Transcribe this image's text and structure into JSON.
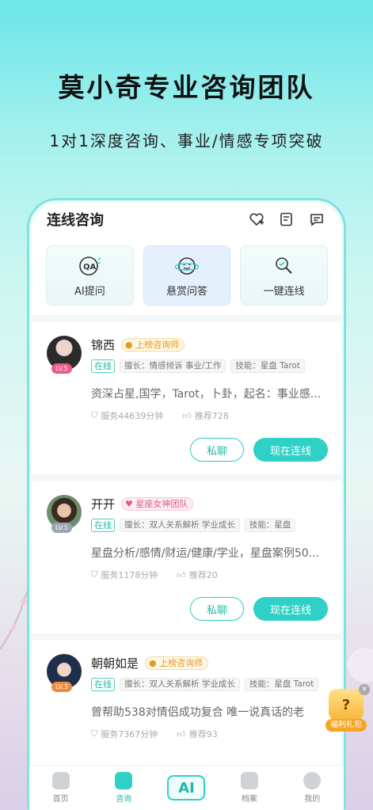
{
  "hero": {
    "title": "莫小奇专业咨询团队",
    "subtitle": "1对1深度咨询、事业/情感专项突破"
  },
  "topbar": {
    "title": "连线咨询",
    "icons": [
      "heart-plus-icon",
      "note-icon",
      "message-icon"
    ]
  },
  "quick_actions": [
    {
      "label": "AI提问",
      "icon": "qa-icon"
    },
    {
      "label": "悬赏问答",
      "icon": "planet-smile-icon"
    },
    {
      "label": "一键连线",
      "icon": "search-link-icon"
    }
  ],
  "consultants": [
    {
      "name": "锦西",
      "level": "LV.5",
      "badge": "上榜咨询师",
      "online": "在线",
      "tags": [
        "擅长：情感倾诉 事业/工作",
        "技能：星盘 Tarot"
      ],
      "desc": "资深占星,国学，Tarot，卜卦，起名：事业感...",
      "service": "服务44639分钟",
      "recommend": "推荐728",
      "chat_label": "私聊",
      "connect_label": "现在连线"
    },
    {
      "name": "开开",
      "level": "LV.1",
      "badge": "星座女神团队",
      "online": "在线",
      "tags": [
        "擅长：双人关系解析 学业成长",
        "技能：星盘"
      ],
      "desc": "星盘分析/感情/财运/健康/学业，星盘案例50...",
      "service": "服务1178分钟",
      "recommend": "推荐20",
      "chat_label": "私聊",
      "connect_label": "现在连线"
    },
    {
      "name": "朝朝如是",
      "level": "LV.3",
      "badge": "上榜咨询师",
      "online": "在线",
      "tags": [
        "擅长：双人关系解析 学业成长",
        "技能：星盘 Tarot"
      ],
      "desc": "曾帮助538对情侣成功复合  唯一说真话的老",
      "service": "服务7367分钟",
      "recommend": "推荐93"
    }
  ],
  "gift": {
    "label": "福利礼包"
  },
  "tabs": [
    {
      "label": "首页",
      "active": false
    },
    {
      "label": "咨询",
      "active": true
    },
    {
      "label": "AI",
      "active": false
    },
    {
      "label": "档案",
      "active": false
    },
    {
      "label": "我的",
      "active": false
    }
  ],
  "colors": {
    "accent": "#2fd0c5",
    "accent_text": "#1fb8a8",
    "gold_badge": "#e39b20",
    "pink_badge": "#e05b8c"
  }
}
